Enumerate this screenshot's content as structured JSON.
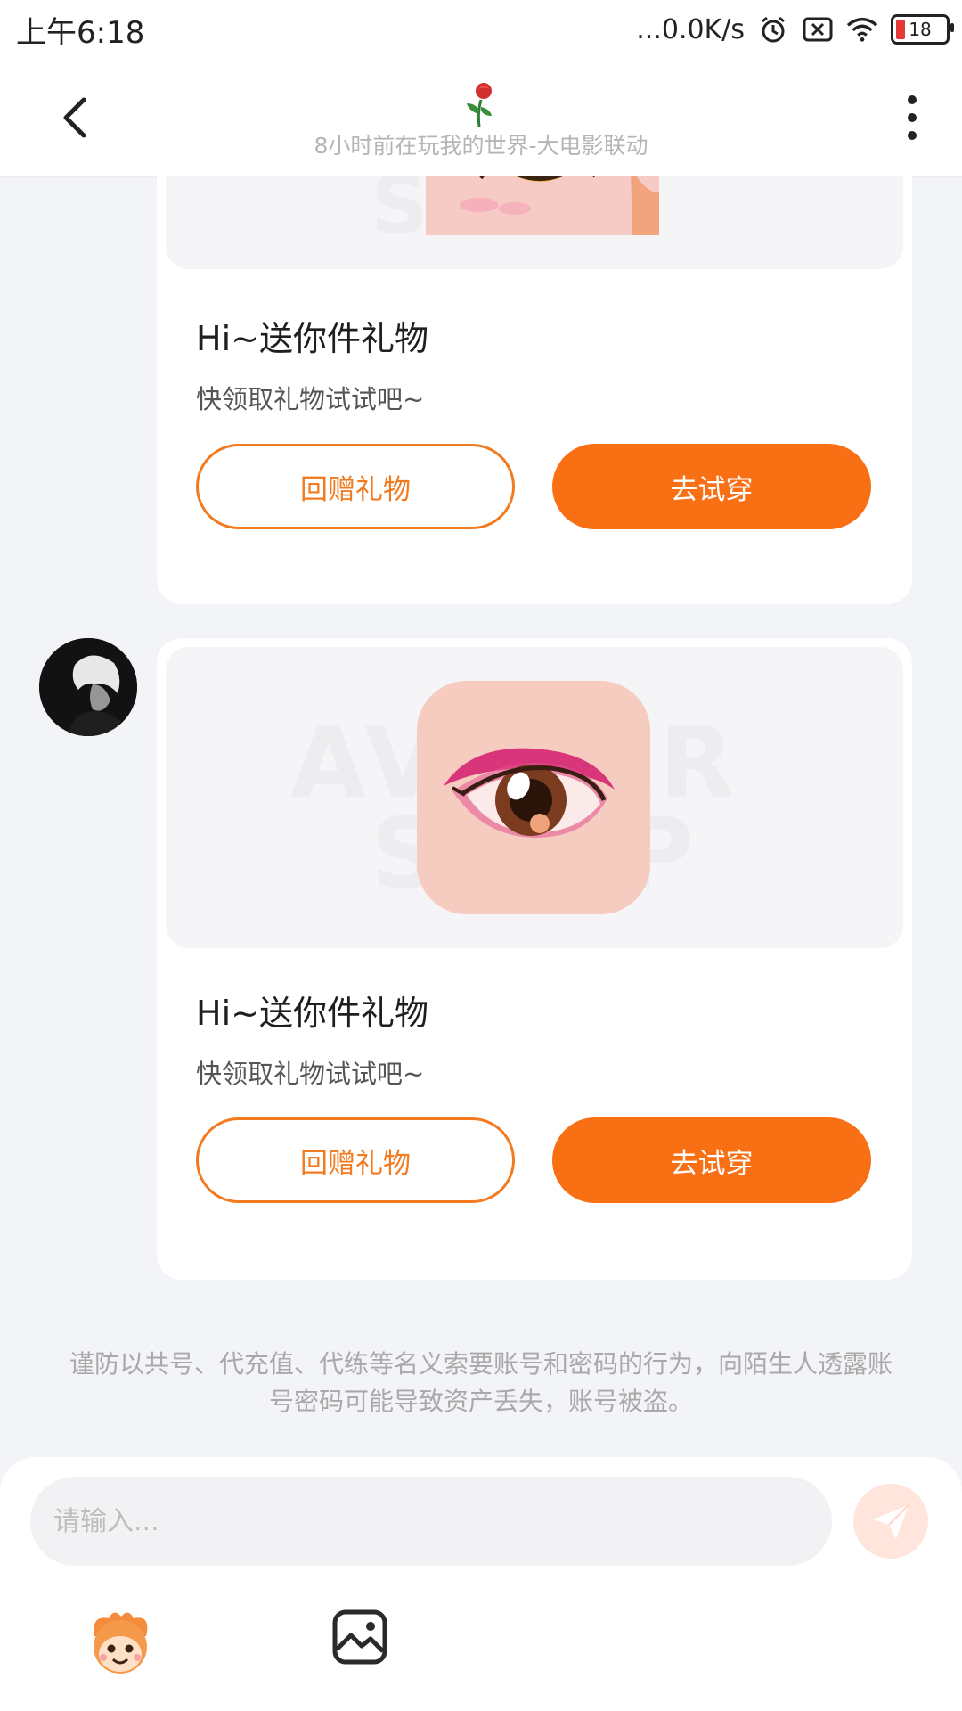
{
  "status_bar": {
    "time": "上午6:18",
    "network_speed": "...0.0K/s",
    "battery_level": "18",
    "icons": [
      "alarm-icon",
      "sim-disabled-icon",
      "wifi-icon",
      "battery-icon"
    ]
  },
  "header": {
    "subtitle": "8小时前在玩我的世界-大电影联动",
    "icons": [
      "back-arrow-icon",
      "rose-icon",
      "more-vertical-icon"
    ]
  },
  "messages": [
    {
      "title": "Hi~送你件礼物",
      "desc": "快领取礼物试试吧~",
      "btn_return": "回赠礼物",
      "btn_try": "去试穿",
      "image_icon": "cat-eye-icon"
    },
    {
      "title": "Hi~送你件礼物",
      "desc": "快领取礼物试试吧~",
      "btn_return": "回赠礼物",
      "btn_try": "去试穿",
      "image_icon": "pink-eyeshadow-eye-icon"
    }
  ],
  "warning": "谨防以共号、代充值、代练等名义索要账号和密码的行为，向陌生人透露账号密码可能导致资产丢失，账号被盗。",
  "input": {
    "placeholder": "请输入...",
    "value": ""
  },
  "colors": {
    "accent": "#f96f14",
    "accent_outline": "#f27a1f",
    "page_bg": "#f3f4f7"
  }
}
